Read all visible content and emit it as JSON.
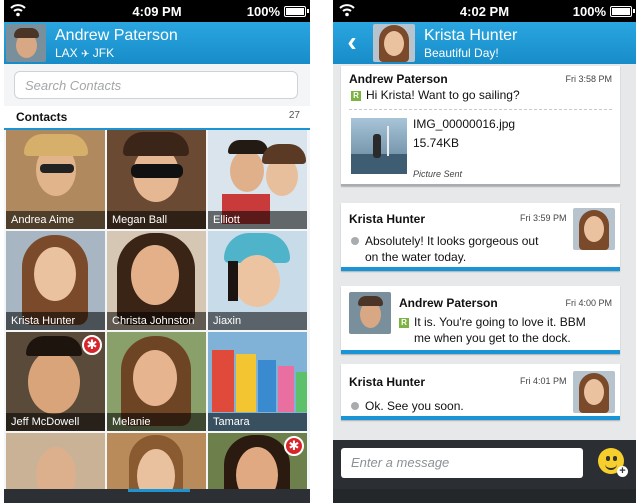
{
  "left": {
    "status": {
      "time": "4:09 PM",
      "battery": "100%"
    },
    "header": {
      "name": "Andrew Paterson",
      "route_from": "LAX",
      "route_to": "JFK"
    },
    "search": {
      "placeholder": "Search Contacts"
    },
    "contacts": {
      "label": "Contacts",
      "count": "27"
    },
    "tiles": [
      {
        "name": "Andrea Aime",
        "badge": false
      },
      {
        "name": "Megan Ball",
        "badge": false
      },
      {
        "name": "Elliott",
        "badge": false
      },
      {
        "name": "Krista Hunter",
        "badge": false
      },
      {
        "name": "Christa Johnston",
        "badge": false
      },
      {
        "name": "Jiaxin",
        "badge": false
      },
      {
        "name": "Jeff McDowell",
        "badge": true
      },
      {
        "name": "Melanie",
        "badge": false
      },
      {
        "name": "Tamara",
        "badge": false
      },
      {
        "name": "",
        "badge": false
      },
      {
        "name": "",
        "badge": false
      },
      {
        "name": "",
        "badge": true
      }
    ]
  },
  "right": {
    "status": {
      "time": "4:02 PM",
      "battery": "100%"
    },
    "header": {
      "name": "Krista Hunter",
      "status": "Beautiful Day!"
    },
    "messages": [
      {
        "sender": "Andrew Paterson",
        "time": "Fri 3:58 PM",
        "text": "Hi Krista! Want to go sailing?",
        "flag": "R"
      },
      {
        "file_name": "IMG_00000016.jpg",
        "file_size": "15.74KB",
        "file_status": "Picture Sent"
      },
      {
        "sender": "Krista Hunter",
        "time": "Fri 3:59 PM",
        "text_line1": "Absolutely! It looks gorgeous out",
        "text_line2": "on the water today."
      },
      {
        "sender": "Andrew Paterson",
        "time": "Fri 4:00 PM",
        "text_line1": "It is. You're going to love it. BBM",
        "text_line2": "me when you get to the dock.",
        "flag": "R"
      },
      {
        "sender": "Krista Hunter",
        "time": "Fri 4:01 PM",
        "text": "Ok. See you soon."
      }
    ],
    "composer": {
      "placeholder": "Enter a message"
    }
  },
  "colors": {
    "accent": "#1a94d4",
    "header": "#1f9ad6",
    "badge": "#d7262b",
    "read_flag": "#7cb342"
  }
}
